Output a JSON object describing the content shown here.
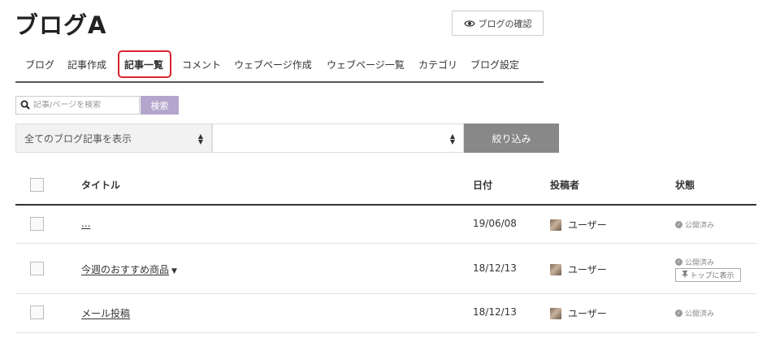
{
  "header": {
    "title": "ブログA",
    "preview_label": "ブログの確認"
  },
  "tabs": [
    {
      "label": "ブログ",
      "active": false
    },
    {
      "label": "記事作成",
      "active": false
    },
    {
      "label": "記事一覧",
      "active": true
    },
    {
      "label": "コメント",
      "active": false
    },
    {
      "label": "ウェブページ作成",
      "active": false
    },
    {
      "label": "ウェブページ一覧",
      "active": false
    },
    {
      "label": "カテゴリ",
      "active": false
    },
    {
      "label": "ブログ設定",
      "active": false
    }
  ],
  "search": {
    "placeholder": "記事/ページを検索",
    "value": "",
    "button_label": "検索"
  },
  "filters": {
    "select1_value": "全てのブログ記事を表示",
    "select2_value": "",
    "apply_label": "絞り込み"
  },
  "table": {
    "columns": [
      "タイトル",
      "日付",
      "投稿者",
      "状態"
    ],
    "rows": [
      {
        "title": "...",
        "date": "19/06/08",
        "author": "ユーザー",
        "status": "公開済み",
        "badge": ""
      },
      {
        "title": "今週のおすすめ商品",
        "date": "18/12/13",
        "author": "ユーザー",
        "status": "公開済み",
        "badge": "トップに表示"
      },
      {
        "title": "メール投稿",
        "date": "18/12/13",
        "author": "ユーザー",
        "status": "公開済み",
        "badge": ""
      }
    ]
  },
  "icons": {
    "preview": "eye-icon",
    "search": "search-icon",
    "status": "check-circle-icon",
    "select": "up-down-arrows-icon",
    "badge": "pin-icon",
    "title_menu": "caret-down-icon"
  },
  "colors": {
    "active_tab_highlight": "#d9262b",
    "search_button": "#b3a6cc",
    "filter_button": "#888888"
  }
}
